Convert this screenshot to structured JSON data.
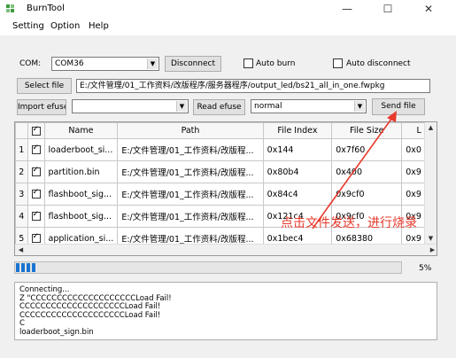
{
  "window": {
    "title": "BurnTool",
    "minimize_glyph": "—",
    "maximize_glyph": "☐",
    "close_glyph": "✕"
  },
  "menu": [
    "Setting",
    "Option",
    "Help"
  ],
  "com": {
    "label": "COM:",
    "value": "COM36",
    "connect_button": "Disconnect",
    "auto_burn_label": "Auto burn",
    "auto_disconnect_label": "Auto disconnect"
  },
  "file": {
    "select_button": "Select file",
    "path": "E:/文件管理/01_工作资料/改版程序/服务器程序/output_led/bs21_all_in_one.fwpkg"
  },
  "efuse": {
    "import_button": "Import efuse",
    "efuse_value": "",
    "read_button": "Read efuse",
    "mode_value": "normal",
    "send_button": "Send file"
  },
  "table": {
    "columns": [
      "",
      "Name",
      "Path",
      "File Index",
      "File Size",
      "L"
    ],
    "rows": [
      {
        "num": "1",
        "name": "loaderboot_si...",
        "path": "E:/文件管理/01_工作资料/改版程...",
        "index": "0x144",
        "size": "0x7f60",
        "l": "0x0"
      },
      {
        "num": "2",
        "name": "partition.bin",
        "path": "E:/文件管理/01_工作资料/改版程...",
        "index": "0x80b4",
        "size": "0x400",
        "l": "0x9"
      },
      {
        "num": "3",
        "name": "flashboot_sig...",
        "path": "E:/文件管理/01_工作资料/改版程...",
        "index": "0x84c4",
        "size": "0x9cf0",
        "l": "0x9"
      },
      {
        "num": "4",
        "name": "flashboot_sig...",
        "path": "E:/文件管理/01_工作资料/改版程...",
        "index": "0x121c4",
        "size": "0x9cf0",
        "l": "0x9"
      },
      {
        "num": "5",
        "name": "application_si...",
        "path": "E:/文件管理/01_工作资料/改版程...",
        "index": "0x1bec4",
        "size": "0x68380",
        "l": "0x9"
      }
    ]
  },
  "progress": {
    "percent_text": "5%",
    "fraction": 0.05
  },
  "log": [
    "Connecting...",
    "Z \"CCCCCCCCCCCCCCCCCCCCLoad Fail!",
    "CCCCCCCCCCCCCCCCCCCCLoad Fail!",
    "CCCCCCCCCCCCCCCCCCCCLoad Fail!",
    "C",
    "loaderboot_sign.bin"
  ],
  "annotation": {
    "text": "点击文件发送，进行烧录",
    "color": "#e8392b"
  },
  "colors": {
    "progress": "#1b74d1"
  }
}
